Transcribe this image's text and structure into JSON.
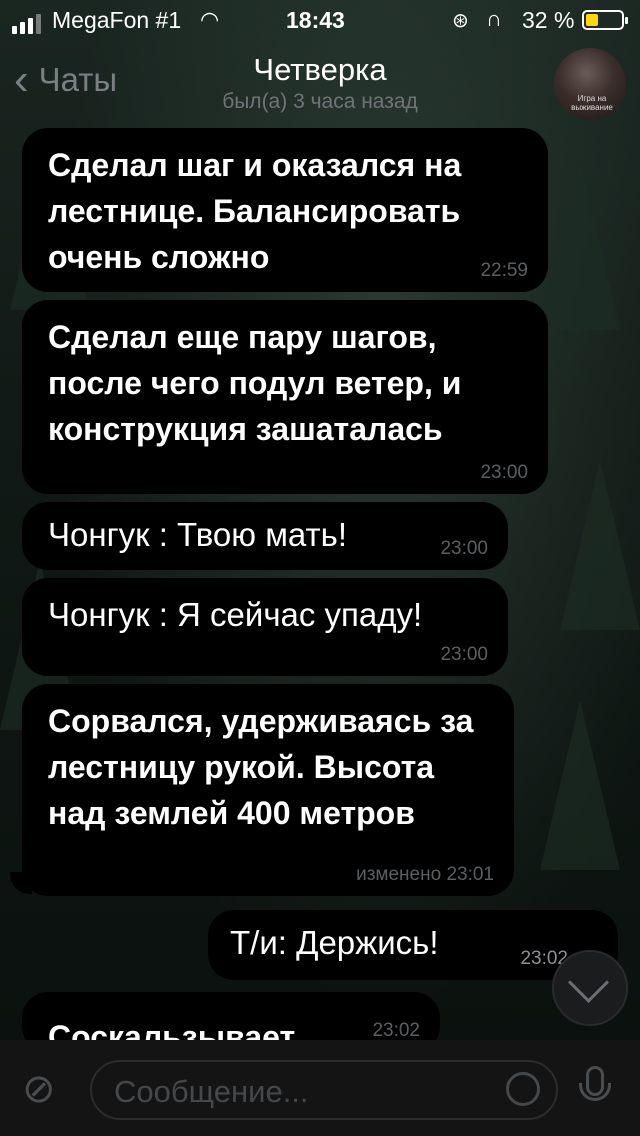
{
  "status_bar": {
    "carrier": "MegaFon #1",
    "time": "18:43",
    "battery_percent": "32 %",
    "battery_level": 0.32,
    "icons": [
      "signal-icon",
      "wifi-icon",
      "orientation-lock-icon",
      "headphones-icon",
      "battery-icon"
    ]
  },
  "nav": {
    "back_label": "Чаты",
    "title": "Четверка",
    "subtitle": "был(а) 3 часа назад",
    "avatar_caption": "Игра на выживание"
  },
  "messages": [
    {
      "text": "Сделал шаг и оказался на лестнице. Балансировать очень сложно",
      "time": "22:59",
      "bold": true,
      "direction": "in"
    },
    {
      "text": "Сделал еще пару шагов, после чего подул ветер, и конструкция зашаталась",
      "time": "23:00",
      "bold": true,
      "direction": "in"
    },
    {
      "text": "Чонгук : Твою мать!",
      "time": "23:00",
      "bold": false,
      "direction": "in"
    },
    {
      "text": "Чонгук : Я сейчас упаду!",
      "time": "23:00",
      "bold": false,
      "direction": "in"
    },
    {
      "text": "Сорвался, удерживаясь за лестницу  рукой. Высота над землей 400 метров",
      "time": "изменено 23:01",
      "bold": true,
      "direction": "in"
    },
    {
      "text": "Т/и: Держись!",
      "time": "23:02",
      "bold": false,
      "direction": "out",
      "read": true
    },
    {
      "text": "Соскальзывает",
      "time": "23:02",
      "bold": true,
      "direction": "in"
    }
  ],
  "input": {
    "placeholder": "Сообщение..."
  },
  "colors": {
    "bubble": "#000000",
    "timestamp": "#5c5f62",
    "battery_fill": "#ffd60a"
  }
}
